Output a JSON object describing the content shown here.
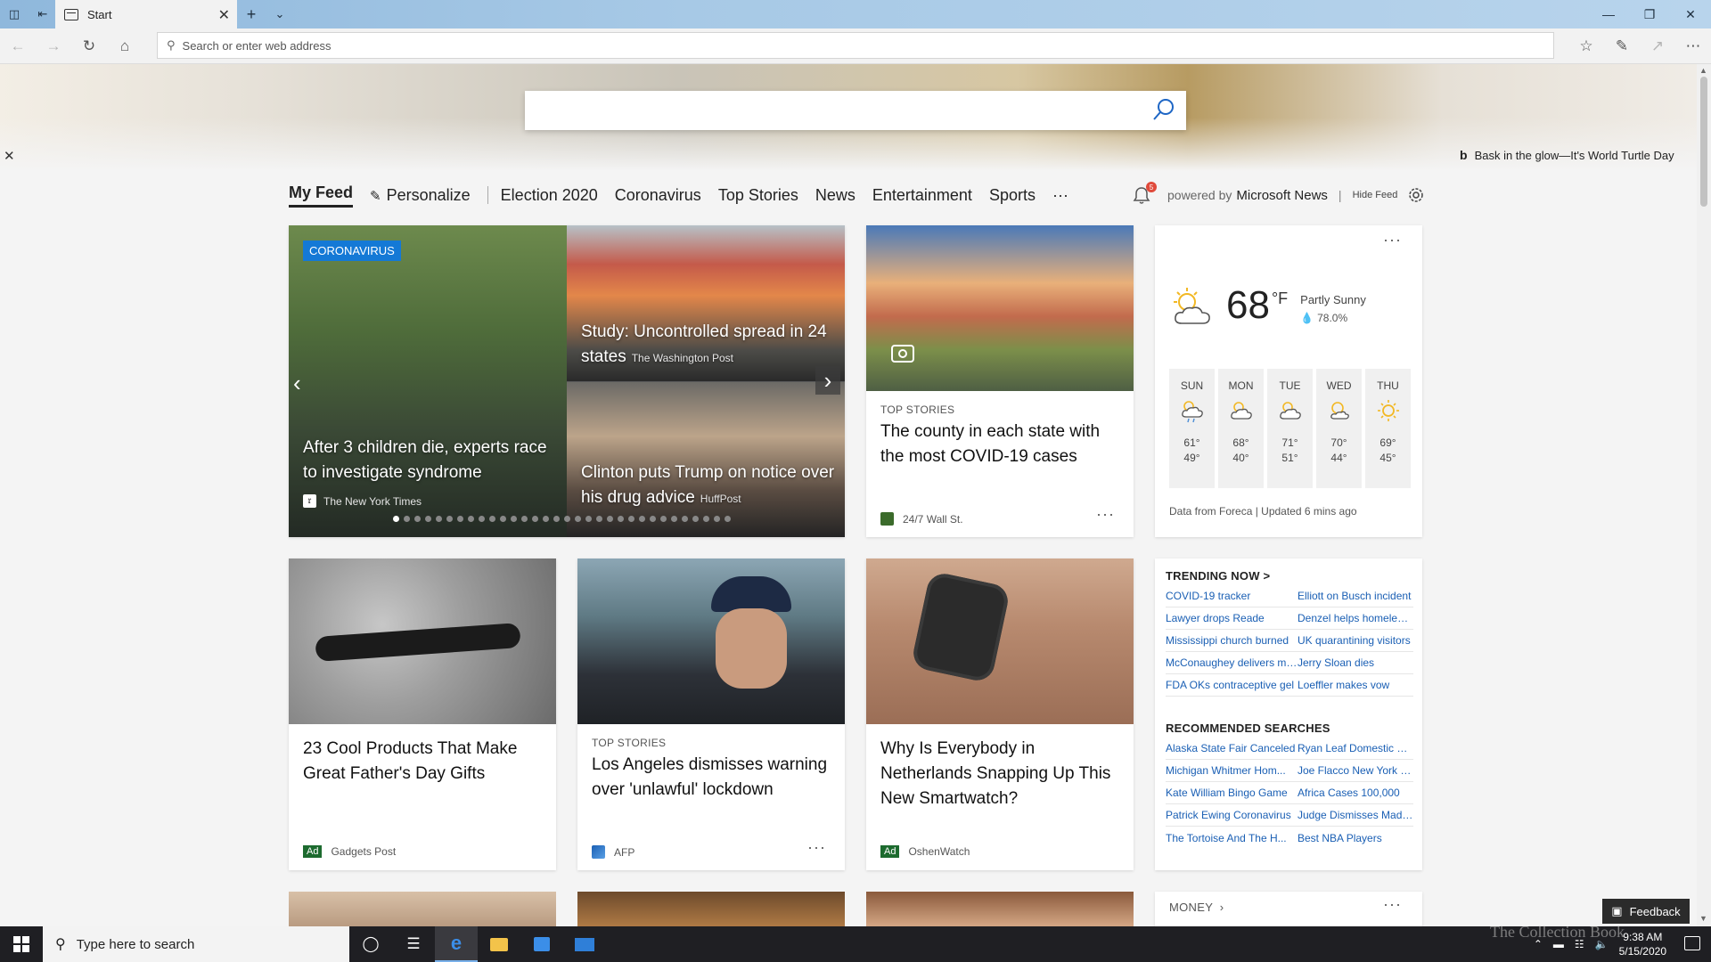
{
  "browser": {
    "tab_title": "Start",
    "address_placeholder": "Search or enter web address"
  },
  "hero": {
    "image_credit": "Bask in the glow—It's World Turtle Day"
  },
  "feed_nav": {
    "active": "My Feed",
    "personalize": "Personalize",
    "items": [
      "Election 2020",
      "Coronavirus",
      "Top Stories",
      "News",
      "Entertainment",
      "Sports"
    ],
    "more": "···",
    "notification_count": "5",
    "powered_by": "powered by",
    "provider": "Microsoft News",
    "hide_feed": "Hide Feed"
  },
  "carousel": {
    "badge": "CORONAVIRUS",
    "main": {
      "title": "After 3 children die, experts race to investigate syndrome",
      "source": "The New York Times"
    },
    "top": {
      "title": "Study: Uncontrolled spread in 24 states",
      "source": "The Washington Post"
    },
    "bottom": {
      "title": "Clinton puts Trump on notice over his drug advice",
      "source": "HuffPost"
    }
  },
  "cards": [
    {
      "kicker": "TOP STORIES",
      "title": "The county in each state with the most COVID-19 cases",
      "source": "24/7 Wall St."
    },
    {
      "kicker": "",
      "title": "23 Cool Products That Make Great Father's Day Gifts",
      "source": "Gadgets Post",
      "ad": "Ad"
    },
    {
      "kicker": "TOP STORIES",
      "title": "Los Angeles dismisses warning over 'unlawful' lockdown",
      "source": "AFP"
    },
    {
      "kicker": "",
      "title": "Why Is Everybody in Netherlands Snapping Up This New Smartwatch?",
      "source": "OshenWatch",
      "ad": "Ad"
    }
  ],
  "weather": {
    "temp": "68",
    "unit": "°F",
    "condition": "Partly Sunny",
    "precip": "78.0%",
    "days": [
      {
        "name": "SUN",
        "hi": "61°",
        "lo": "49°"
      },
      {
        "name": "MON",
        "hi": "68°",
        "lo": "40°"
      },
      {
        "name": "TUE",
        "hi": "71°",
        "lo": "51°"
      },
      {
        "name": "WED",
        "hi": "70°",
        "lo": "44°"
      },
      {
        "name": "THU",
        "hi": "69°",
        "lo": "45°"
      }
    ],
    "footer": "Data from Foreca | Updated 6 mins ago"
  },
  "trending": {
    "title": "TRENDING NOW >",
    "rows": [
      [
        "COVID-19 tracker",
        "Elliott on Busch incident"
      ],
      [
        "Lawyer drops Reade",
        "Denzel helps homeless man"
      ],
      [
        "Mississippi church burned",
        "UK quarantining visitors"
      ],
      [
        "McConaughey delivers masks",
        "Jerry Sloan dies"
      ],
      [
        "FDA OKs contraceptive gel",
        "Loeffler makes vow"
      ]
    ],
    "rec_title": "RECOMMENDED SEARCHES",
    "rec_rows": [
      [
        "Alaska State Fair Canceled",
        "Ryan Leaf Domestic Ba..."
      ],
      [
        "Michigan Whitmer Hom...",
        "Joe Flacco New York Je..."
      ],
      [
        "Kate William Bingo Game",
        "Africa Cases 100,000"
      ],
      [
        "Patrick Ewing Coronavirus",
        "Judge Dismisses Madd..."
      ],
      [
        "The Tortoise And The H...",
        "Best NBA Players"
      ]
    ]
  },
  "money_label": "MONEY",
  "feedback": "Feedback",
  "taskbar": {
    "search_placeholder": "Type here to search",
    "time": "9:38 AM",
    "date": "5/15/2020"
  },
  "watermark": "The Collection Book"
}
